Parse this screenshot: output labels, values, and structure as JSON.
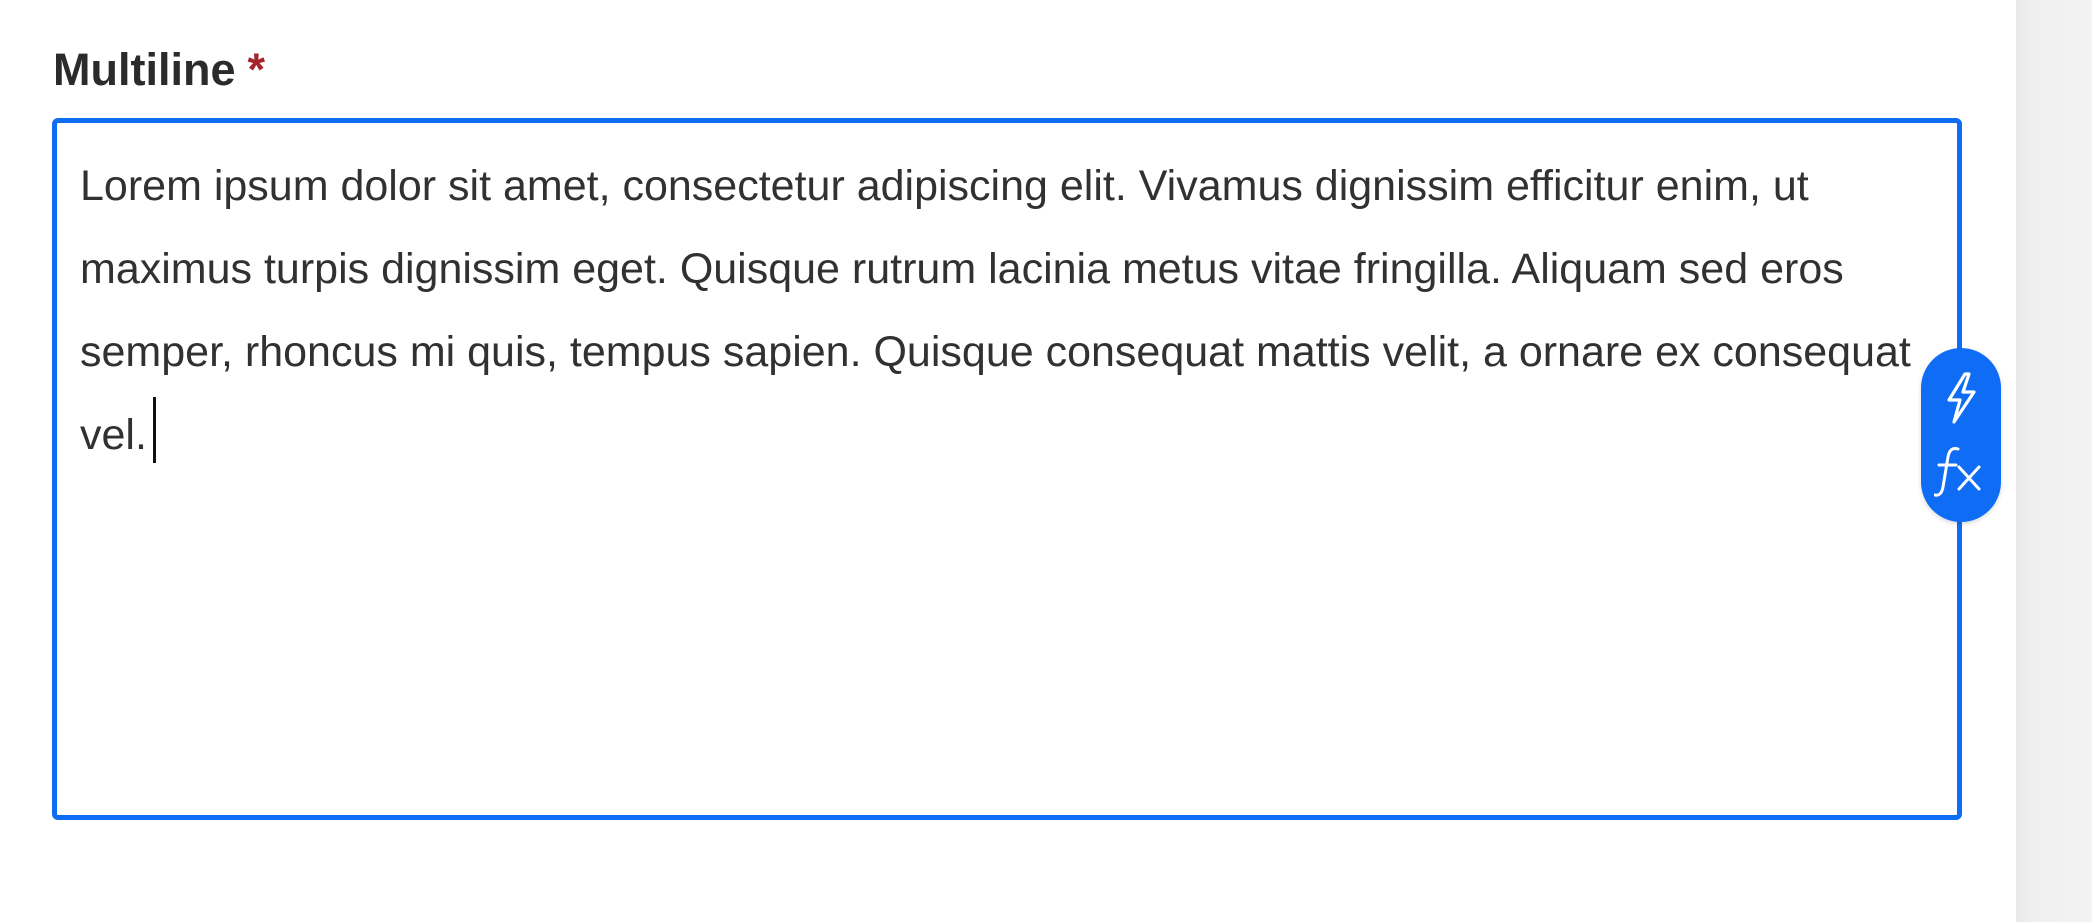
{
  "field": {
    "label": "Multiline",
    "required_marker": "*",
    "value": "Lorem ipsum dolor sit amet, consectetur adipiscing elit. Vivamus dignissim efficitur enim, ut maximus turpis dignissim eget. Quisque rutrum lacinia metus vitae fringilla. Aliquam sed eros semper, rhoncus mi quis, tempus sapien. Quisque consequat mattis velit, a ornare ex consequat vel."
  },
  "formula_button": {
    "icons": [
      "lightning-icon",
      "fx-icon"
    ]
  },
  "colors": {
    "accent": "#0f6cf5",
    "required": "#a4262c",
    "text": "#323130",
    "label": "#2b2b2b"
  }
}
